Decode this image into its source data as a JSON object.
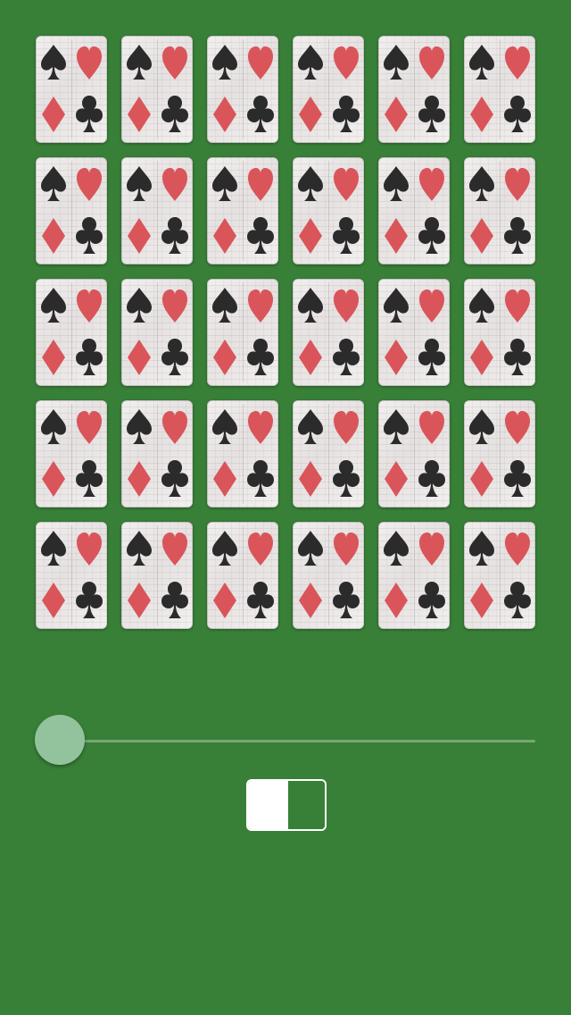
{
  "background_color": "#388038",
  "card_grid": {
    "rows": 5,
    "columns": 6,
    "card_face": "four-suit-card-back-icon",
    "suits": [
      "spade",
      "heart",
      "diamond",
      "club"
    ],
    "suit_colors": {
      "spade": "#2b2b2b",
      "heart": "#d9555a",
      "diamond": "#d9555a",
      "club": "#2b2b2b"
    }
  },
  "slider": {
    "value": 0,
    "track_color": "#75a875",
    "knob_color": "#93c39d"
  },
  "toggle": {
    "state": "on",
    "color": "#ffffff"
  }
}
